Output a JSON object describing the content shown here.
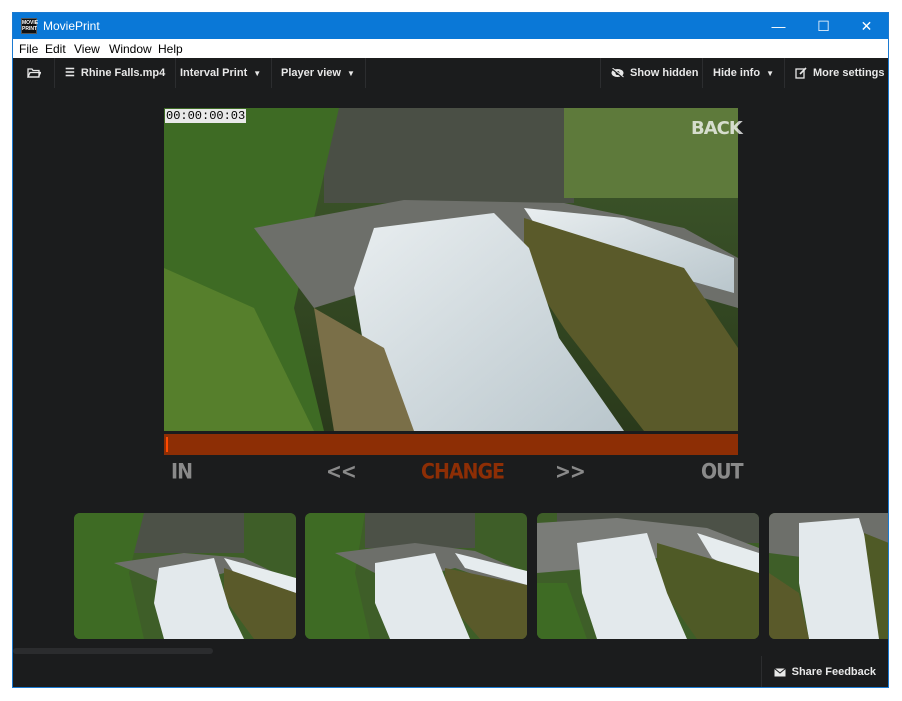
{
  "window": {
    "title": "MoviePrint",
    "app_icon_text": "MOVIE PRINT",
    "minimize_glyph": "—",
    "maximize_glyph": "☐",
    "close_glyph": "✕"
  },
  "menu": [
    "File",
    "Edit",
    "View",
    "Window",
    "Help"
  ],
  "toolbar": {
    "file_name": "Rhine Falls.mp4",
    "print_mode": "Interval Print",
    "view_mode": "Player view",
    "show_hidden": "Show hidden",
    "hide_info": "Hide info",
    "more_settings": "More settings"
  },
  "player": {
    "timecode": "00:00:00:03",
    "overlay_label": "BACK",
    "scrub_position_fraction": 0.004
  },
  "controls": {
    "in": "IN",
    "prev": "<<",
    "change": "CHANGE",
    "next": ">>",
    "out": "OUT"
  },
  "thumbnails": [
    {
      "name": "thumb-1"
    },
    {
      "name": "thumb-2"
    },
    {
      "name": "thumb-3"
    },
    {
      "name": "thumb-4"
    }
  ],
  "footer": {
    "share_feedback": "Share Feedback"
  },
  "colors": {
    "titlebar": "#0a78d7",
    "background": "#1b1c1d",
    "scrub_bar": "#8d2e05",
    "change_text": "#8d2e05"
  }
}
